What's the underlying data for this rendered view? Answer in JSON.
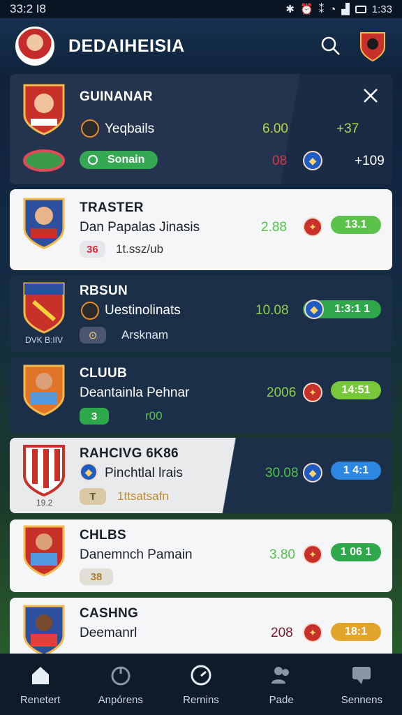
{
  "status_bar": {
    "time": "33:2 I8",
    "clock_right": "1:33"
  },
  "header": {
    "title": "DEDAIHEISIA"
  },
  "featured": {
    "title": "GUINANAR",
    "row1_label": "Yeqbails",
    "row1_value": "6.00",
    "row1_change": "+37",
    "pill_label": "Sonain",
    "row2_value": "08",
    "row2_change": "+109"
  },
  "cards": [
    {
      "title": "TRASTER",
      "subtitle": "Dan Papalas Jinasis",
      "chip": "36",
      "tag": "1t.ssz/ub",
      "value": "2.88",
      "pill": "13.1",
      "pill_color": "#5cc34a"
    },
    {
      "title": "RBSUN",
      "subtitle": "Uestinolinats",
      "crest_caption": "DVK B:IIV",
      "chip": "",
      "tag": "Arsknam",
      "value": "10.08",
      "pill": "1:3:1 1",
      "pill_color": "#2fa84c"
    },
    {
      "title": "CLUUB",
      "subtitle": "Deantainla Pehnar",
      "chip": "3",
      "tag": "r00",
      "value": "2006",
      "pill": "14:51",
      "pill_color": "#78c93a"
    },
    {
      "title": "RAHCIVG 6K86",
      "subtitle": "Pinchtlal lrais",
      "crest_caption": "19.2",
      "chip": "T",
      "tag": "1ttsatsafn",
      "value": "30.08",
      "pill": "1 4:1",
      "pill_color": "#2d86e0"
    },
    {
      "title": "CHLBS",
      "subtitle": "Danemnch Pamain",
      "chip": "38",
      "tag": "",
      "value": "3.80",
      "pill": "1 06 1",
      "pill_color": "#2fa84c"
    },
    {
      "title": "CASHNG",
      "subtitle": "Deemanrl",
      "chip": "",
      "tag": "",
      "value": "208",
      "pill": "18:1",
      "pill_color": "#e2a42b"
    }
  ],
  "nav": [
    {
      "label": "Renetert",
      "icon": "home-icon"
    },
    {
      "label": "Anpórens",
      "icon": "timer-icon"
    },
    {
      "label": "Rernins",
      "icon": "speedometer-icon"
    },
    {
      "label": "Pade",
      "icon": "people-icon"
    },
    {
      "label": "Sennens",
      "icon": "message-icon"
    }
  ]
}
